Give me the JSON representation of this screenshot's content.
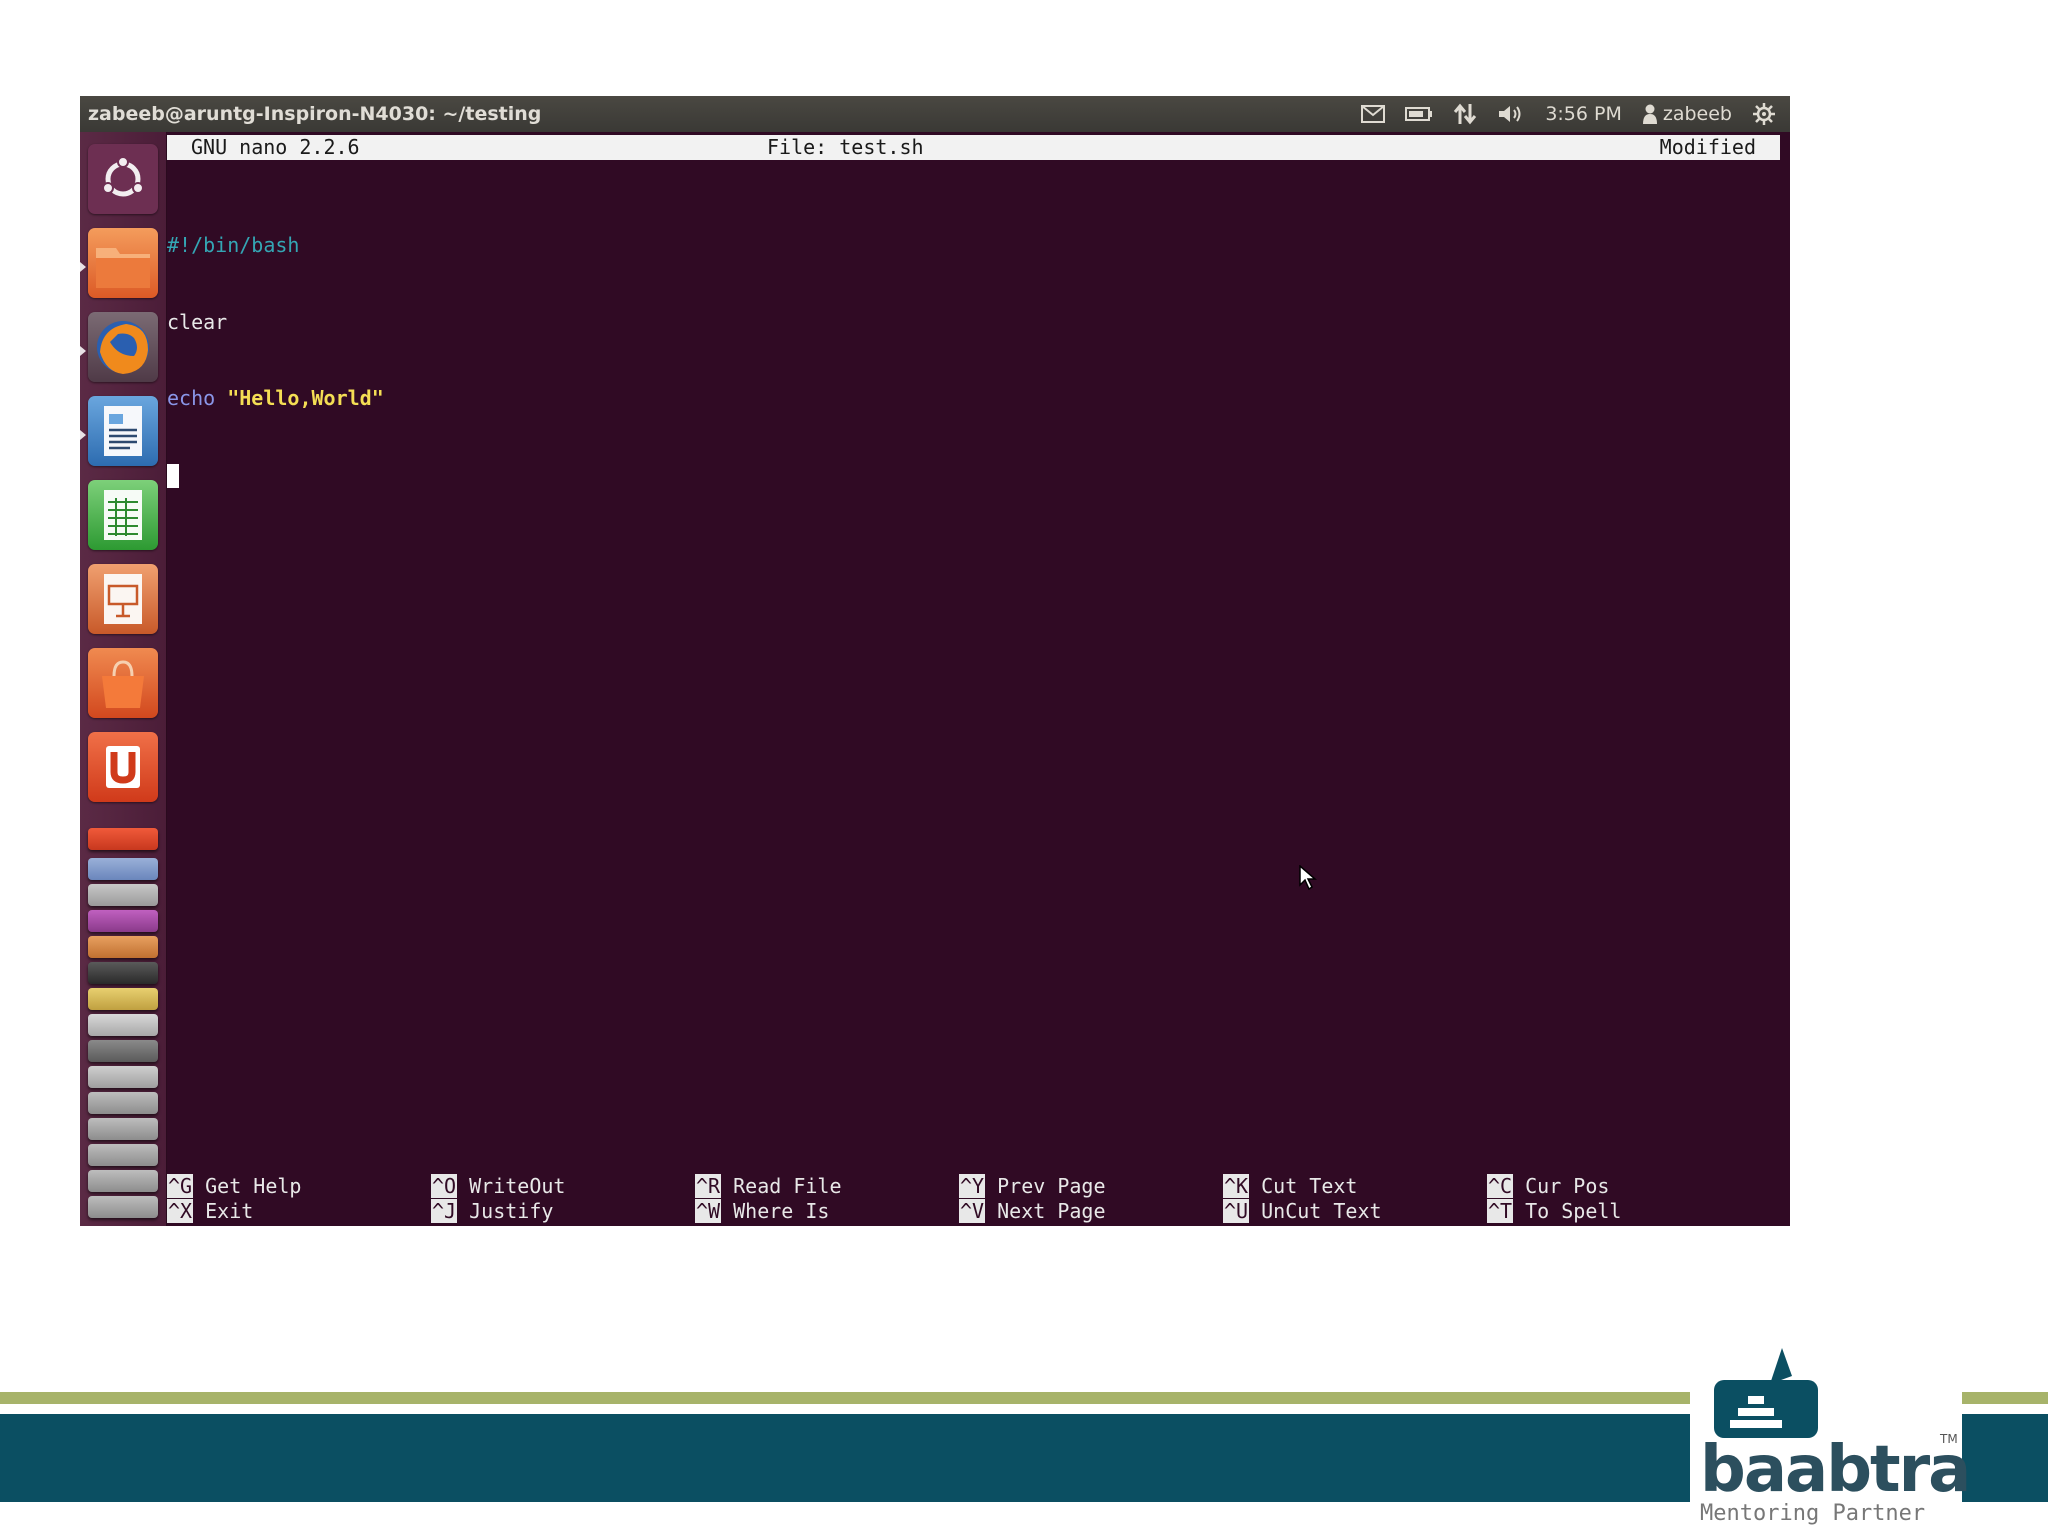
{
  "window": {
    "title": "zabeeb@aruntg-Inspiron-N4030: ~/testing"
  },
  "indicators": {
    "time": "3:56 PM",
    "user": "zabeeb",
    "icons": [
      "mail-icon",
      "battery-icon",
      "network-icon",
      "volume-icon",
      "user-icon",
      "gear-icon"
    ]
  },
  "launcher": {
    "items": [
      "dash-home",
      "files",
      "firefox",
      "libreoffice-writer",
      "libreoffice-calc",
      "libreoffice-impress",
      "ubuntu-software-center",
      "ubuntu-one"
    ]
  },
  "nano": {
    "version": "GNU nano 2.2.6",
    "file_label": "File: test.sh",
    "status": "Modified",
    "lines": [
      {
        "text": "#!/bin/bash"
      },
      {
        "text": "clear"
      },
      {
        "keyword": "echo",
        "string": "\"Hello,World\""
      }
    ],
    "shortcuts": [
      {
        "key": "^G",
        "label": "Get Help"
      },
      {
        "key": "^O",
        "label": "WriteOut"
      },
      {
        "key": "^R",
        "label": "Read File"
      },
      {
        "key": "^Y",
        "label": "Prev Page"
      },
      {
        "key": "^K",
        "label": "Cut Text"
      },
      {
        "key": "^C",
        "label": "Cur Pos"
      },
      {
        "key": "^X",
        "label": "Exit"
      },
      {
        "key": "^J",
        "label": "Justify"
      },
      {
        "key": "^W",
        "label": "Where Is"
      },
      {
        "key": "^V",
        "label": "Next Page"
      },
      {
        "key": "^U",
        "label": "UnCut Text"
      },
      {
        "key": "^T",
        "label": "To Spell"
      }
    ]
  },
  "branding": {
    "name": "baabtra",
    "tagline": "Mentoring Partner",
    "trademark": "TM"
  },
  "colors": {
    "terminal_bg": "#300a24",
    "band_green": "#a7b36a",
    "band_teal": "#0b4f62"
  }
}
